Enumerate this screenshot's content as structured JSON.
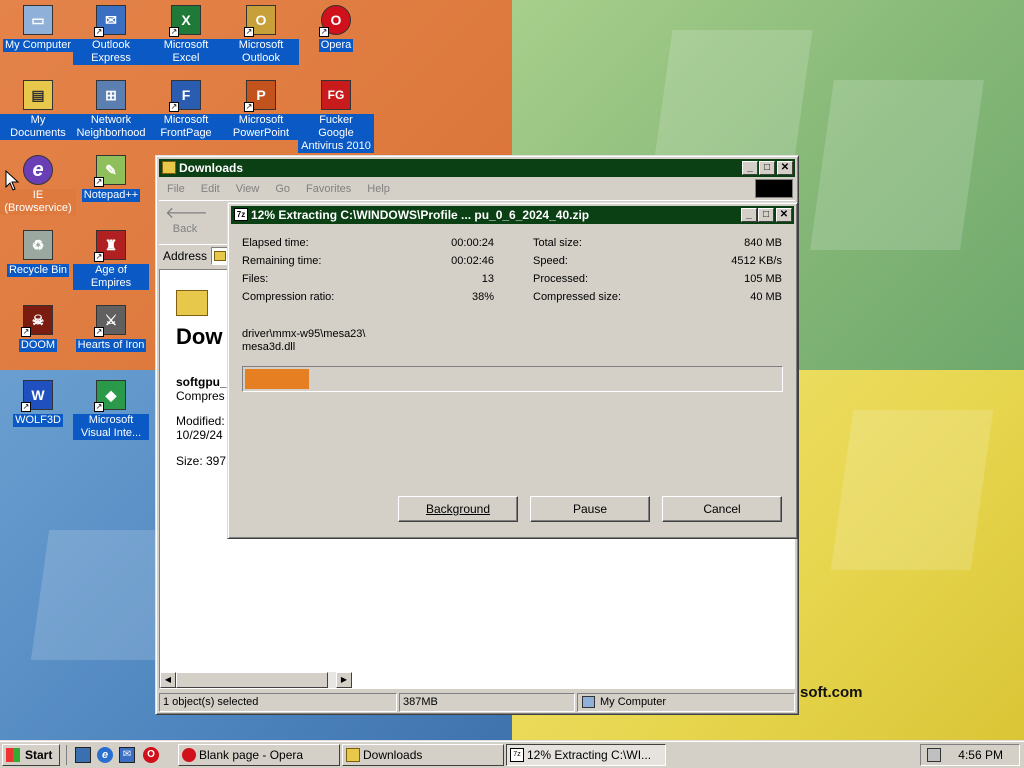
{
  "desktop": {
    "icons": [
      {
        "label": "My Computer",
        "icon": "my-computer-icon",
        "color": "#8fb0d8",
        "glyph": "▭"
      },
      {
        "label": "Outlook Express",
        "icon": "outlook-express-icon",
        "color": "#3b6fc2",
        "glyph": "✉"
      },
      {
        "label": "Microsoft Excel",
        "icon": "excel-icon",
        "color": "#1f7a3a",
        "glyph": "X"
      },
      {
        "label": "Microsoft Outlook",
        "icon": "outlook-icon",
        "color": "#c8a03a",
        "glyph": "O"
      },
      {
        "label": "Opera",
        "icon": "opera-icon",
        "color": "#d0101a",
        "glyph": "O"
      },
      {
        "label": "My Documents",
        "icon": "my-documents-icon",
        "color": "#e8c84a",
        "glyph": "▤"
      },
      {
        "label": "Network Neighborhood",
        "icon": "network-neighborhood-icon",
        "color": "#5a7fb0",
        "glyph": "⊞"
      },
      {
        "label": "Microsoft FrontPage",
        "icon": "frontpage-icon",
        "color": "#2a5cb0",
        "glyph": "F"
      },
      {
        "label": "Microsoft PowerPoint",
        "icon": "powerpoint-icon",
        "color": "#c2531d",
        "glyph": "P"
      },
      {
        "label": "Fucker Google Antivirus 2010",
        "icon": "antivirus-icon",
        "color": "#c81c1c",
        "glyph": "FG"
      },
      {
        "label": "IE (Browservice)",
        "icon": "internet-explorer-icon",
        "color": "#6a3fb5",
        "glyph": "e"
      },
      {
        "label": "Notepad++",
        "icon": "notepad-plus-plus-icon",
        "color": "#8fbf5a",
        "glyph": "✎"
      },
      {
        "label": "Recycle Bin",
        "icon": "recycle-bin-icon",
        "color": "#9aa8a0",
        "glyph": "♻"
      },
      {
        "label": "Age of Empires",
        "icon": "age-of-empires-icon",
        "color": "#b02020",
        "glyph": "♜"
      },
      {
        "label": "DOOM",
        "icon": "doom-icon",
        "color": "#7a1c10",
        "glyph": "☠"
      },
      {
        "label": "Hearts of Iron",
        "icon": "hearts-of-iron-icon",
        "color": "#606060",
        "glyph": "⚔"
      },
      {
        "label": "WOLF3D",
        "icon": "wolf3d-icon",
        "color": "#2050c0",
        "glyph": "W"
      },
      {
        "label": "Microsoft Visual Inte...",
        "icon": "visual-interdev-icon",
        "color": "#2a9a4a",
        "glyph": "◆"
      }
    ],
    "watermark": "soft.com"
  },
  "explorer": {
    "title": "Downloads",
    "menu": [
      "File",
      "Edit",
      "View",
      "Go",
      "Favorites",
      "Help"
    ],
    "back_label": "Back",
    "address_label": "Address",
    "folder_heading": "Dow",
    "selected_name": "softgpu_",
    "selected_type": "Compres",
    "modified_label": "Modified:",
    "modified_value": "10/29/24",
    "size_text": "Size: 397",
    "status": {
      "selected": "1 object(s) selected",
      "size": "387MB",
      "zone": "My Computer"
    }
  },
  "extract_dialog": {
    "title": "12% Extracting C:\\WINDOWS\\Profile ... pu_0_6_2024_40.zip",
    "left_stats": [
      {
        "label": "Elapsed time:",
        "value": "00:00:24"
      },
      {
        "label": "Remaining time:",
        "value": "00:02:46"
      },
      {
        "label": "Files:",
        "value": "13"
      },
      {
        "label": "Compression ratio:",
        "value": "38%"
      }
    ],
    "right_stats": [
      {
        "label": "Total size:",
        "value": "840 MB"
      },
      {
        "label": "Speed:",
        "value": "4512 KB/s"
      },
      {
        "label": "Processed:",
        "value": "105 MB"
      },
      {
        "label": "Compressed size:",
        "value": "40 MB"
      }
    ],
    "current_path": "driver\\mmx-w95\\mesa23\\",
    "current_file": "mesa3d.dll",
    "progress": 0.12,
    "progress_color": "#e67e22",
    "buttons": {
      "background": "Background",
      "pause": "Pause",
      "cancel": "Cancel"
    }
  },
  "taskbar": {
    "start_label": "Start",
    "quick_launch": [
      "show-desktop-icon",
      "internet-explorer-icon",
      "outlook-express-icon",
      "opera-icon"
    ],
    "tasks": [
      {
        "label": "Blank page - Opera",
        "icon": "opera-icon"
      },
      {
        "label": "Downloads",
        "icon": "folder-icon"
      },
      {
        "label": "12% Extracting C:\\WI...",
        "icon": "7zip-icon"
      }
    ],
    "clock": "4:56 PM"
  }
}
